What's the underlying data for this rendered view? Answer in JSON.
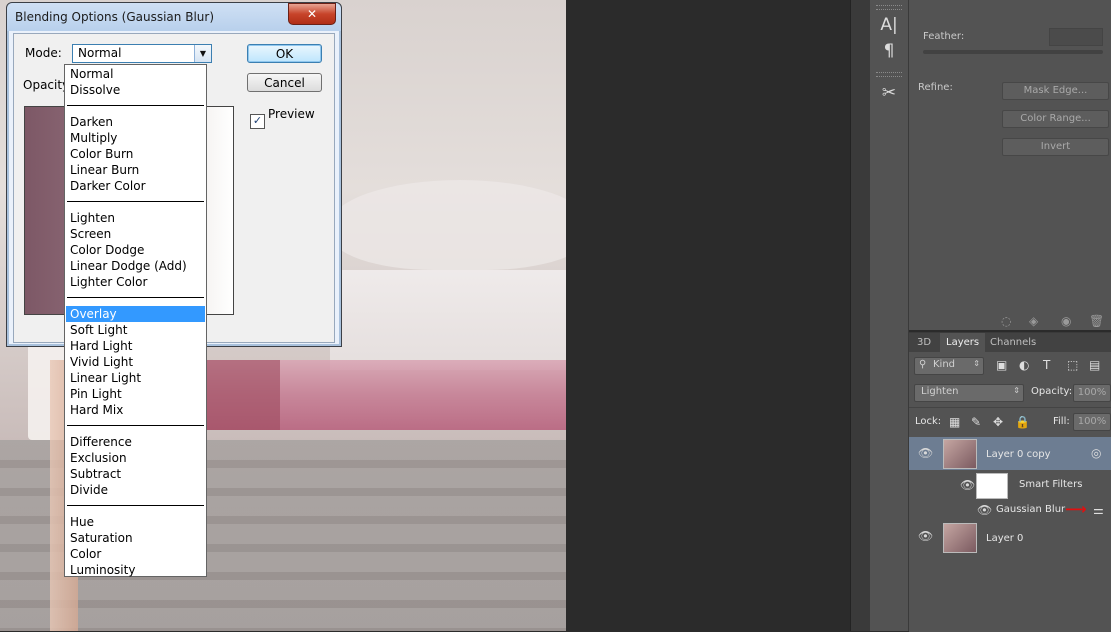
{
  "dialog": {
    "title": "Blending Options (Gaussian Blur)",
    "close_glyph": "✕",
    "mode_label": "Mode:",
    "mode_value": "Normal",
    "opacity_label": "Opacity",
    "ok_label": "OK",
    "cancel_label": "Cancel",
    "preview_label": "Preview",
    "preview_checked": true
  },
  "dropdown": {
    "groups": [
      [
        "Normal",
        "Dissolve"
      ],
      [
        "Darken",
        "Multiply",
        "Color Burn",
        "Linear Burn",
        "Darker Color"
      ],
      [
        "Lighten",
        "Screen",
        "Color Dodge",
        "Linear Dodge (Add)",
        "Lighter Color"
      ],
      [
        "Overlay",
        "Soft Light",
        "Hard Light",
        "Vivid Light",
        "Linear Light",
        "Pin Light",
        "Hard Mix"
      ],
      [
        "Difference",
        "Exclusion",
        "Subtract",
        "Divide"
      ],
      [
        "Hue",
        "Saturation",
        "Color",
        "Luminosity"
      ]
    ],
    "highlighted": "Overlay"
  },
  "toolstrip": {
    "items": [
      "text-tool-icon",
      "paragraph-icon",
      "tools-icon"
    ]
  },
  "properties": {
    "feather_label": "Feather:",
    "refine_label": "Refine:",
    "mask_edge_label": "Mask Edge...",
    "color_range_label": "Color Range...",
    "invert_label": "Invert"
  },
  "layers_panel": {
    "tabs": [
      "3D",
      "Layers",
      "Channels"
    ],
    "active_tab": "Layers",
    "kind_label": "Kind",
    "blend_mode": "Lighten",
    "opacity_label": "Opacity:",
    "opacity_value": "100%",
    "lock_label": "Lock:",
    "fill_label": "Fill:",
    "fill_value": "100%",
    "layers": [
      {
        "name": "Layer 0 copy",
        "selected": true
      },
      {
        "name": "Smart Filters"
      },
      {
        "name": "Gaussian Blur"
      },
      {
        "name": "Layer 0"
      }
    ]
  },
  "colors": {
    "selection_blue": "#3399ff",
    "panel_gray": "#535353",
    "annotation_red": "#e01010"
  }
}
